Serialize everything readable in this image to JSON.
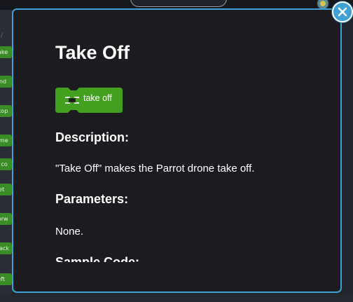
{
  "background": {
    "sidebar_chips": [
      "take",
      "and",
      "stop",
      "eme",
      "a co",
      "set",
      "forw",
      "back",
      "left"
    ]
  },
  "modal": {
    "title": "Take Off",
    "block": {
      "label": "take off",
      "icon": "drone-icon",
      "color": "#43a01f"
    },
    "sections": {
      "description_heading": "Description:",
      "description_text": "\"Take Off\" makes the Parrot drone take off.",
      "parameters_heading": "Parameters:",
      "parameters_text": "None.",
      "sample_heading": "Sample Code:"
    },
    "border_color": "#3ea0d6"
  },
  "close_button": {
    "icon": "close-icon"
  }
}
